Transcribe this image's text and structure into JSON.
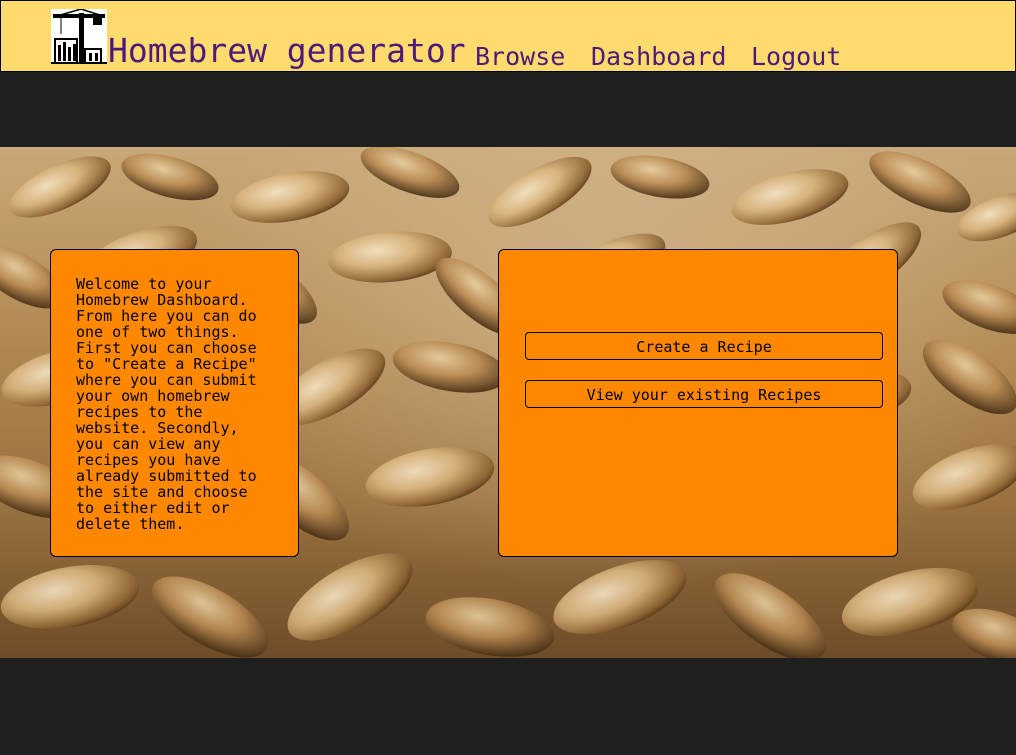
{
  "header": {
    "title": "Homebrew generator",
    "logo_icon": "construction-crane-icon",
    "nav": {
      "browse": "Browse",
      "dashboard": "Dashboard",
      "logout": "Logout"
    }
  },
  "dashboard": {
    "welcome_text": "Welcome to your\nHomebrew Dashboard.\nFrom here you can do\none of two things.\nFirst you can choose\nto \"Create a Recipe\"\nwhere you can submit\nyour own homebrew\nrecipes to the\nwebsite. Secondly,\nyou can view any\nrecipes you have\nalready submitted to\nthe site and choose\nto either edit or\ndelete them.",
    "create_label": "Create a Recipe",
    "view_label": "View your existing Recipes"
  },
  "colors": {
    "header_bg": "#ffdb6e",
    "nav_text": "#4b1a7a",
    "panel_bg": "#ff8800",
    "page_bg": "#1f1f1f"
  }
}
